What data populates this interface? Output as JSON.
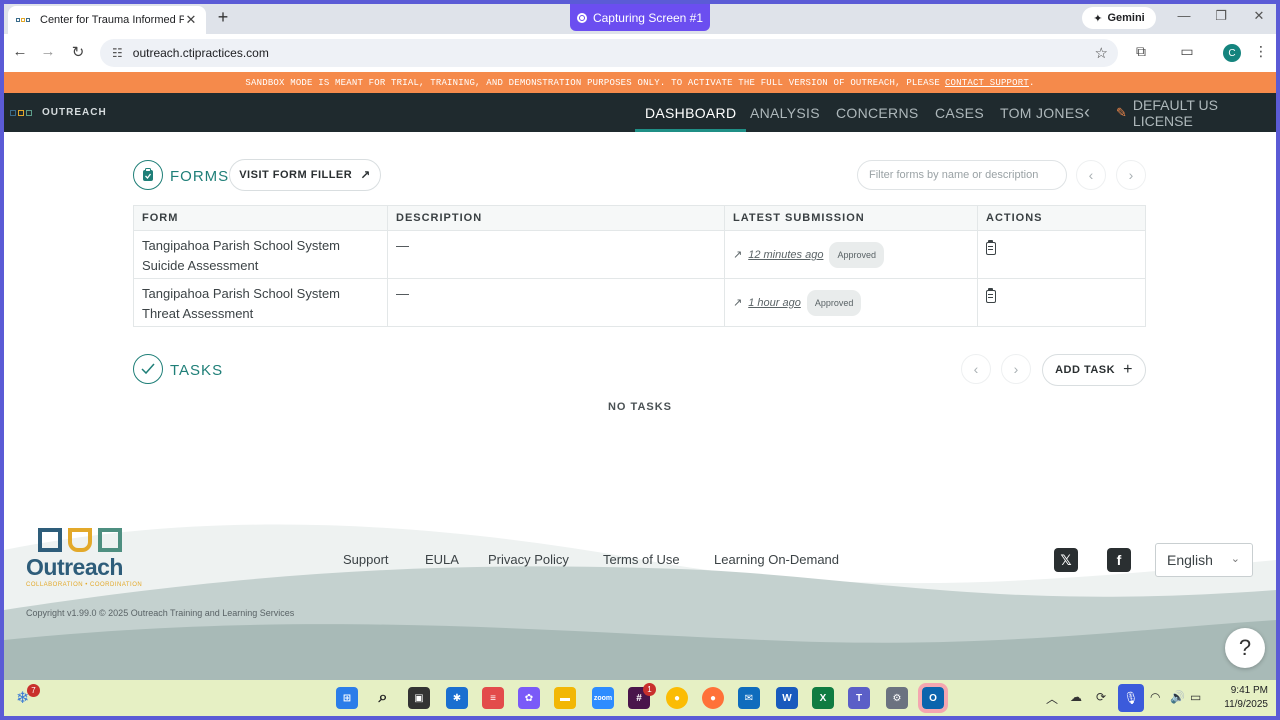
{
  "browser": {
    "tab_title": "Center for Trauma Informed Pra",
    "new_tab": "+",
    "capture_label": "Capturing Screen #1",
    "gemini_label": "Gemini",
    "url": "outreach.ctipractices.com",
    "profile_initial": "C"
  },
  "sandbox_banner": {
    "text": "SANDBOX MODE IS MEANT FOR TRIAL, TRAINING, AND DEMONSTRATION PURPOSES ONLY. TO ACTIVATE THE FULL VERSION OF OUTREACH, PLEASE",
    "link": "CONTACT SUPPORT",
    "suffix": "."
  },
  "appbar": {
    "brand": "OUTREACH",
    "nav": [
      "DASHBOARD",
      "ANALYSIS",
      "CONCERNS",
      "CASES",
      "TOM JONES"
    ],
    "collapse": "‹",
    "license": "DEFAULT US LICENSE"
  },
  "forms": {
    "title": "FORMS",
    "visit_button": "VISIT FORM FILLER",
    "filter_placeholder": "Filter forms by name or description",
    "columns": [
      "FORM",
      "DESCRIPTION",
      "LATEST SUBMISSION",
      "ACTIONS"
    ],
    "rows": [
      {
        "form_line1": "Tangipahoa Parish School System",
        "form_line2": "Suicide Assessment",
        "description": "—",
        "submitted": "12 minutes ago",
        "status": "Approved"
      },
      {
        "form_line1": "Tangipahoa Parish School System",
        "form_line2": "Threat Assessment",
        "description": "—",
        "submitted": "1 hour ago",
        "status": "Approved"
      }
    ]
  },
  "tasks": {
    "title": "TASKS",
    "add_button": "ADD TASK",
    "empty": "NO TASKS"
  },
  "footer": {
    "logo_word": "Outreach",
    "logo_tag": "COLLABORATION • COORDINATION",
    "links": [
      "Support",
      "EULA",
      "Privacy Policy",
      "Terms of Use",
      "Learning On-Demand"
    ],
    "language": "English",
    "copyright": "Copyright v1.99.0 © 2025 Outreach Training and Learning Services",
    "help": "?"
  },
  "taskbar": {
    "weather_badge": "7",
    "slack_badge": "1",
    "time": "9:41 PM",
    "date": "11/9/2025"
  },
  "colors": {
    "accent": "#1f7f78",
    "banner": "#f58a4b",
    "appbar": "#1f2a2e",
    "screen_border": "#5b5bd6"
  }
}
